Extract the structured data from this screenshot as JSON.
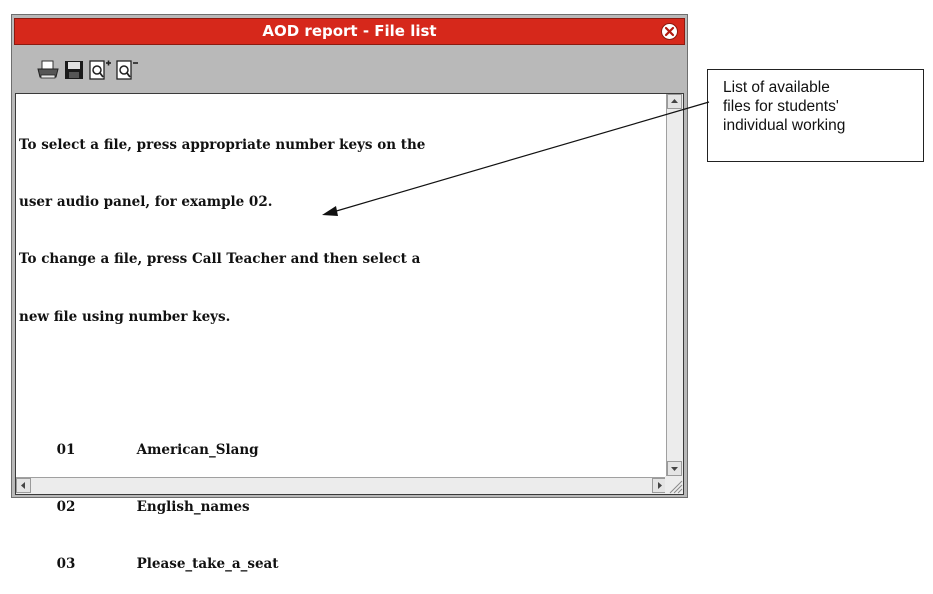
{
  "window": {
    "title": "AOD report - File list",
    "close_icon": "close-circle-icon"
  },
  "toolbar": {
    "buttons": [
      {
        "icon": "print-icon",
        "label": "Print"
      },
      {
        "icon": "save-icon",
        "label": "Save"
      },
      {
        "icon": "zoom-in-icon",
        "label": "Zoom in"
      },
      {
        "icon": "zoom-out-icon",
        "label": "Zoom out"
      }
    ]
  },
  "content": {
    "instructions": [
      "To select a file, press appropriate number keys on the",
      "user audio panel, for example 02.",
      "To change a file, press Call Teacher and then select a",
      "new file using number keys."
    ],
    "files": [
      {
        "number": "01",
        "name": "American_Slang"
      },
      {
        "number": "02",
        "name": "English_names"
      },
      {
        "number": "03",
        "name": "Please_take_a_seat"
      }
    ]
  },
  "callout": {
    "text": "List of available\nfiles for students'\nindividual working"
  },
  "colors": {
    "titlebar": "#d6281b",
    "window_frame": "#b9b9b9",
    "content_bg": "#ffffff"
  }
}
